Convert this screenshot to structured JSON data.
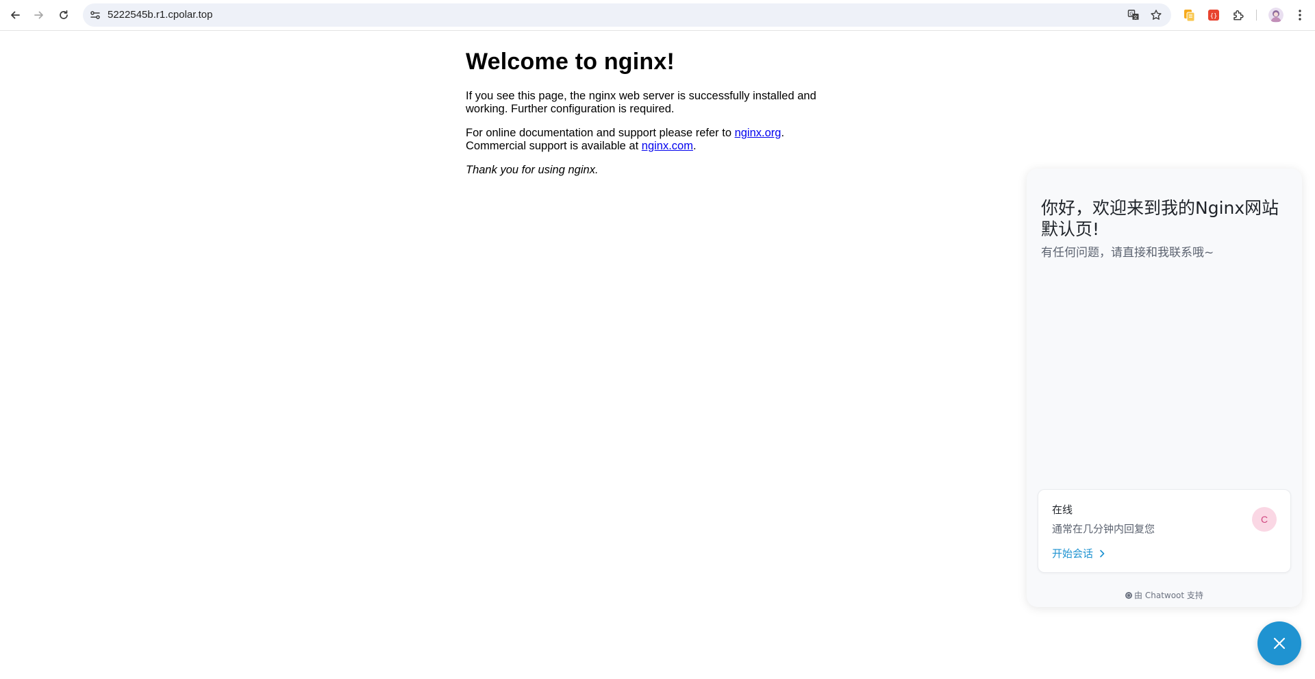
{
  "browser": {
    "url": "5222545b.r1.cpolar.top",
    "icons": {
      "back": "back-arrow-icon",
      "forward": "forward-arrow-icon",
      "reload": "reload-icon",
      "site_info": "site-settings-icon",
      "translate": "translate-icon",
      "bookmark": "star-icon",
      "ext1": "extension-copy-icon",
      "ext2": "extension-red-icon",
      "extensions": "puzzle-icon",
      "profile": "profile-avatar-icon",
      "menu": "kebab-menu-icon"
    }
  },
  "page": {
    "heading": "Welcome to nginx!",
    "para1": "If you see this page, the nginx web server is successfully installed and working. Further configuration is required.",
    "para2_prefix": "For online documentation and support please refer to ",
    "link_org": "nginx.org",
    "para2_mid": ".",
    "para2_line2": "Commercial support is available at ",
    "link_com": "nginx.com",
    "para2_end": ".",
    "thanks": "Thank you for using nginx."
  },
  "chat": {
    "title": "你好，欢迎来到我的Nginx网站默认页!",
    "subtitle": "有任何问题，请直接和我联系哦~",
    "status": "在线",
    "reply_time": "通常在几分钟内回复您",
    "start_label": "开始会话",
    "agent_initial": "C",
    "powered_by": "由 Chatwoot 支持",
    "accent_color": "#1f93d1"
  }
}
